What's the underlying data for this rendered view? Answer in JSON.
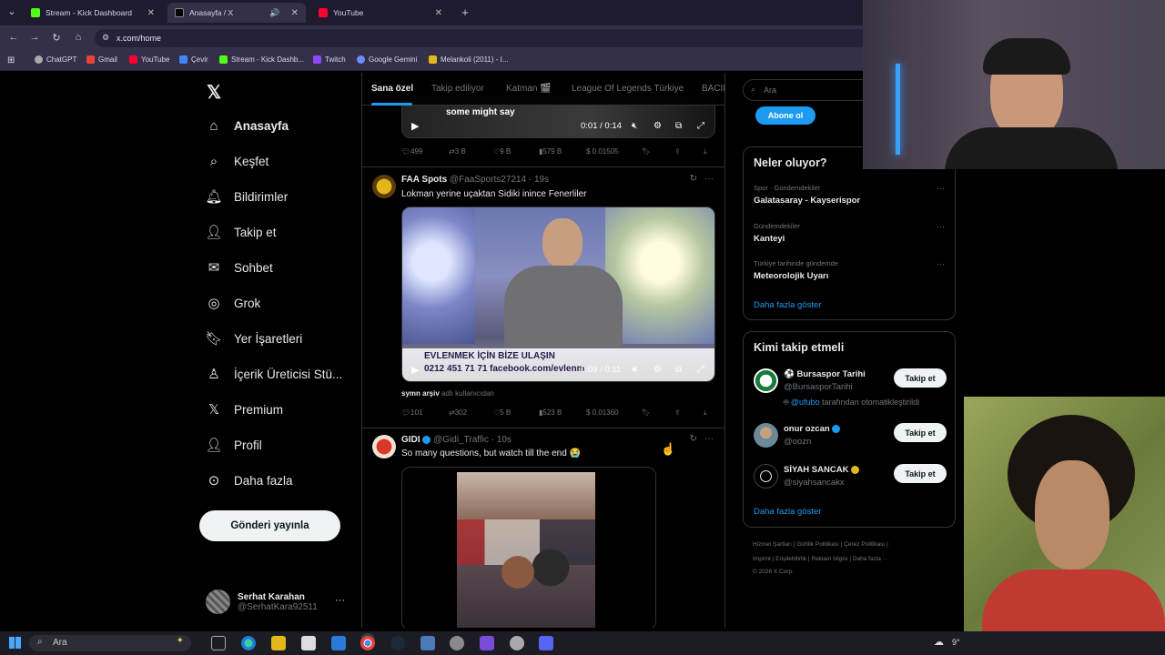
{
  "browser": {
    "tabs": [
      {
        "title": "Stream - Kick Dashboard"
      },
      {
        "title": "Anasayfa / X"
      },
      {
        "title": "YouTube"
      }
    ],
    "url": "x.com/home",
    "bookmarks": [
      "ChatGPT",
      "Gmail",
      "YouTube",
      "Çevir",
      "Stream - Kick Dashb...",
      "Twitch",
      "Google Gemini",
      "Melankoli (2011) - I..."
    ]
  },
  "nav": {
    "items": [
      "Anasayfa",
      "Keşfet",
      "Bildirimler",
      "Takip et",
      "Sohbet",
      "Grok",
      "Yer İşaretleri",
      "İçerik Üreticisi Stü...",
      "Premium",
      "Profil",
      "Daha fazla"
    ],
    "post_button": "Gönderi yayınla",
    "user_name": "Serhat Karahan",
    "user_handle": "@SerhatKara92511"
  },
  "feed": {
    "tabs": [
      "Sana özel",
      "Takip ediliyor",
      "Katman 🎬",
      "League Of Legends Türkiye",
      "BACIL"
    ],
    "prev_tweet": {
      "caption": "some might say",
      "time": "0:01 / 0:14",
      "replies": "499",
      "reposts": "3 B",
      "likes": "9 B",
      "views": "579 B",
      "tip": "$ 0.01505"
    },
    "tweet1": {
      "name": "FAA Spots",
      "handle": "@FaaSports27214",
      "time": "19s",
      "text": "Lokman yerine uçaktan Sidiki inince Fenerliler",
      "banner_line1": "EVLENMEK İÇİN BİZE ULAŞIN",
      "banner_line2": "0212 451 71 71",
      "banner_line3": "facebook.com/evlenm",
      "video_time": "0:09 / 0:11",
      "attribution_name": "symn arşiv",
      "attribution_suffix": "adlı kullanıcıdan",
      "replies": "101",
      "reposts": "302",
      "likes": "5 B",
      "views": "523 B",
      "tip": "$ 0.01360"
    },
    "tweet2": {
      "name": "GIDI",
      "handle": "@Gidi_Traffic",
      "time": "10s",
      "text": "So many questions, but watch till the end 😭"
    }
  },
  "right": {
    "search_placeholder": "Ara",
    "subscribe": "Abone ol",
    "trends_title": "Neler oluyor?",
    "trends": [
      {
        "category": "Spor · Gündemdekiler",
        "name": "Galatasaray - Kayserispor"
      },
      {
        "category": "Gündemdekiler",
        "name": "Kanteyi"
      },
      {
        "category": "Türkiye tarihinde gündemde",
        "name": "Meteorolojik Uyarı"
      }
    ],
    "show_more": "Daha fazla göster",
    "who_title": "Kimi takip etmeli",
    "who": [
      {
        "name": "⚽ Bursaspor Tarihi",
        "handle": "@BursasporTarihi",
        "note_handle": "@ufubo",
        "note": "tarafından otomatikleştirildi"
      },
      {
        "name": "onur ozcan",
        "handle": "@oozn"
      },
      {
        "name": "SİYAH SANCAK",
        "handle": "@siyahsancakx"
      }
    ],
    "follow_label": "Takip et",
    "who_more": "Daha fazla göster",
    "footer1": "Hizmet Şartları | Gizlilik Politikası | Çerez Politikası |",
    "footer2": "Imprint | Erişilebilirlik | Reklam bilgisi | Daha fazla ···",
    "footer3": "© 2026 X Corp."
  },
  "taskbar": {
    "search": "Ara",
    "temp": "9°"
  }
}
